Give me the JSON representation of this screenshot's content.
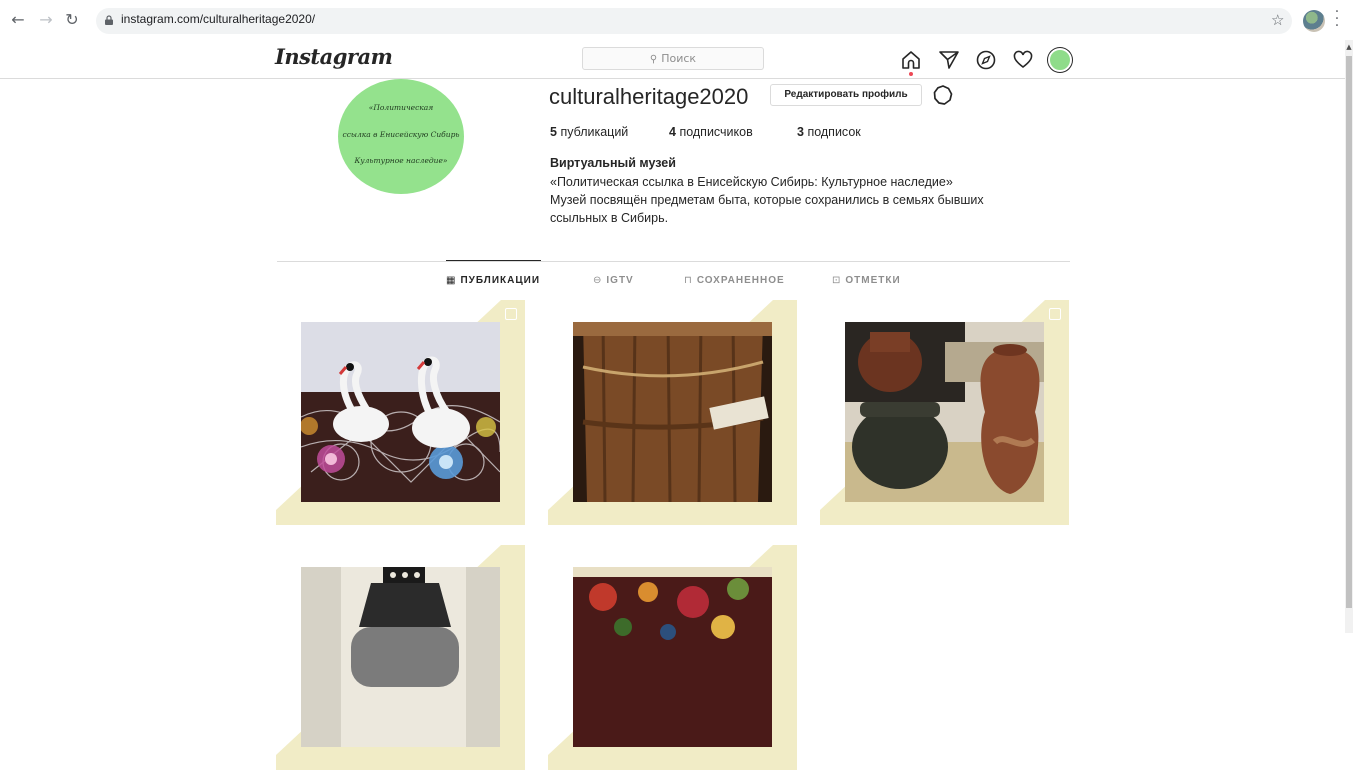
{
  "browser": {
    "url": "instagram.com/culturalheritage2020/"
  },
  "header": {
    "logo": "Instagram",
    "search_placeholder": "Поиск"
  },
  "profile": {
    "avatar_lines": [
      "«Политическая",
      "ссылка в Енисейскую Сибирь",
      "Культурное наследие»"
    ],
    "username": "culturalheritage2020",
    "edit_button": "Редактировать профиль",
    "stats": {
      "posts_count": "5",
      "posts_label": "публикаций",
      "followers_count": "4",
      "followers_label": "подписчиков",
      "following_count": "3",
      "following_label": "подписок"
    },
    "bio_name": "Виртуальный музей",
    "bio_lines": [
      "«Политическая ссылка в Енисейскую Сибирь: Культурное наследие»",
      "Музей посвящён предметам быта, которые сохранились в семьях бывших",
      "ссыльных в Сибирь."
    ]
  },
  "tabs": [
    {
      "label": "ПУБЛИКАЦИИ",
      "icon": "grid-icon",
      "active": true
    },
    {
      "label": "IGTV",
      "icon": "igtv-icon",
      "active": false
    },
    {
      "label": "СОХРАНЕННОЕ",
      "icon": "bookmark-icon",
      "active": false
    },
    {
      "label": "ОТМЕТКИ",
      "icon": "tagged-icon",
      "active": false
    }
  ],
  "posts": [
    {
      "subject": "swans",
      "multi": true
    },
    {
      "subject": "wooden-barrel",
      "multi": false
    },
    {
      "subject": "clay-pots",
      "multi": true
    },
    {
      "subject": "samovar",
      "multi": false
    },
    {
      "subject": "floral-shawl",
      "multi": false
    }
  ],
  "colors": {
    "tile_frame": "#f1ecc6",
    "avatar_green": "#94e28d",
    "accent_red": "#ed4956"
  }
}
